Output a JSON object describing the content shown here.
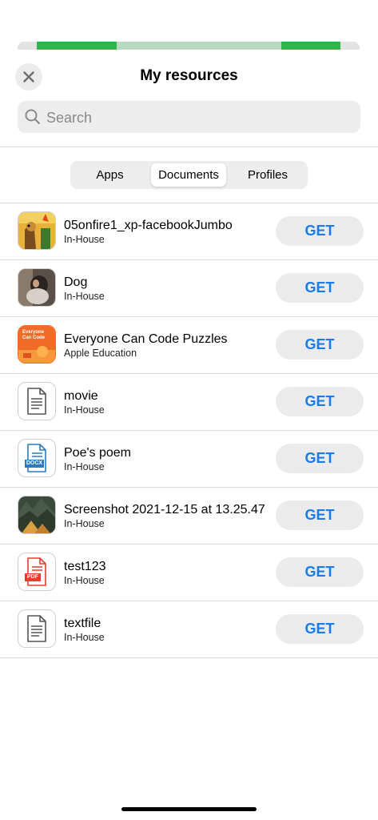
{
  "header": {
    "title": "My resources",
    "close_icon": "close-icon"
  },
  "search": {
    "placeholder": "Search",
    "value": "",
    "icon": "search-icon"
  },
  "tabs": [
    {
      "label": "Apps",
      "active": false
    },
    {
      "label": "Documents",
      "active": true
    },
    {
      "label": "Profiles",
      "active": false
    }
  ],
  "documents": [
    {
      "name": "05onfire1_xp-facebookJumbo",
      "source": "In-House",
      "thumbnail": "cartoon-dog-fire-image",
      "action": "GET"
    },
    {
      "name": "Dog",
      "source": "In-House",
      "thumbnail": "dog-photo",
      "action": "GET"
    },
    {
      "name": "Everyone Can Code Puzzles",
      "source": "Apple Education",
      "thumbnail": "book-cover-orange",
      "thumbnail_text": "Everyone Can Code",
      "action": "GET"
    },
    {
      "name": "movie",
      "source": "In-House",
      "thumbnail": "generic-document-icon",
      "action": "GET"
    },
    {
      "name": "Poe's poem",
      "source": "In-House",
      "thumbnail": "docx-document-icon",
      "thumbnail_text": "DOCX",
      "action": "GET"
    },
    {
      "name": "Screenshot 2021-12-15 at 13.25.47",
      "source": "In-House",
      "thumbnail": "landscape-screenshot",
      "action": "GET"
    },
    {
      "name": "test123",
      "source": "In-House",
      "thumbnail": "pdf-document-icon",
      "thumbnail_text": "PDF",
      "action": "GET"
    },
    {
      "name": "textfile",
      "source": "In-House",
      "thumbnail": "generic-document-icon",
      "action": "GET"
    }
  ],
  "colors": {
    "accent": "#1b7ce6",
    "background_green": "#34b24c",
    "docx_blue": "#2b7bbd",
    "pdf_red": "#e53c2e",
    "puzzles_orange": "#f06a28"
  }
}
